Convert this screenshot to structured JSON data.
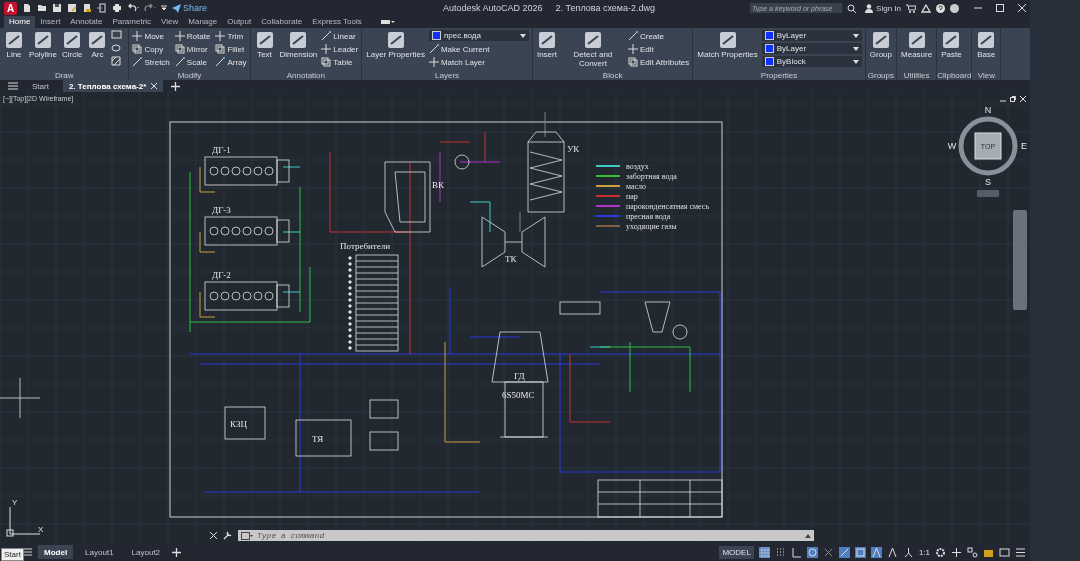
{
  "app": {
    "logo": "A",
    "share": "Share",
    "title": "Autodesk AutoCAD 2026",
    "file_name": "2. Теплова схема-2.dwg",
    "search_placeholder": "Type a keyword or phrase",
    "sign_in": "Sign In"
  },
  "ribbon_tabs": [
    {
      "label": "Home",
      "selected": true
    },
    {
      "label": "Insert",
      "selected": false
    },
    {
      "label": "Annotate",
      "selected": false
    },
    {
      "label": "Parametric",
      "selected": false
    },
    {
      "label": "View",
      "selected": false
    },
    {
      "label": "Manage",
      "selected": false
    },
    {
      "label": "Output",
      "selected": false
    },
    {
      "label": "Collaborate",
      "selected": false
    },
    {
      "label": "Express Tools",
      "selected": false
    }
  ],
  "ribbon_panels": [
    {
      "title": "Draw",
      "items": [
        {
          "label": "Line",
          "kind": "large"
        },
        {
          "label": "Polyline",
          "kind": "large"
        },
        {
          "label": "Circle",
          "kind": "large"
        },
        {
          "label": "Arc",
          "kind": "large"
        }
      ]
    },
    {
      "title": "Modify",
      "items": [
        {
          "label": "Move",
          "kind": "small"
        },
        {
          "label": "Copy",
          "kind": "small"
        },
        {
          "label": "Stretch",
          "kind": "small"
        },
        {
          "label": "Rotate",
          "kind": "small"
        },
        {
          "label": "Mirror",
          "kind": "small"
        },
        {
          "label": "Scale",
          "kind": "small"
        },
        {
          "label": "Trim",
          "kind": "small"
        },
        {
          "label": "Fillet",
          "kind": "small"
        },
        {
          "label": "Array",
          "kind": "small"
        }
      ]
    },
    {
      "title": "Annotation",
      "items": [
        {
          "label": "Text",
          "kind": "large"
        },
        {
          "label": "Dimension",
          "kind": "large"
        },
        {
          "label": "Linear",
          "kind": "small"
        },
        {
          "label": "Leader",
          "kind": "small"
        },
        {
          "label": "Table",
          "kind": "small"
        }
      ]
    },
    {
      "title": "Layers",
      "items": [
        {
          "label": "Layer Properties",
          "kind": "large"
        },
        {
          "label": "прес.вода",
          "kind": "dropdown"
        },
        {
          "label": "Make Current",
          "kind": "small"
        },
        {
          "label": "Match Layer",
          "kind": "small"
        }
      ]
    },
    {
      "title": "Block",
      "items": [
        {
          "label": "Insert",
          "kind": "large"
        },
        {
          "label": "Detect and Convert",
          "kind": "large"
        },
        {
          "label": "Create",
          "kind": "small"
        },
        {
          "label": "Edit",
          "kind": "small"
        },
        {
          "label": "Edit Attributes",
          "kind": "small"
        }
      ]
    },
    {
      "title": "Properties",
      "items": [
        {
          "label": "Match Properties",
          "kind": "large"
        },
        {
          "label": "ByLayer",
          "kind": "dropdown"
        },
        {
          "label": "ByLayer",
          "kind": "dropdown"
        },
        {
          "label": "ByBlock",
          "kind": "dropdown"
        }
      ]
    },
    {
      "title": "Groups",
      "items": [
        {
          "label": "Group",
          "kind": "large"
        }
      ]
    },
    {
      "title": "Utilities",
      "items": [
        {
          "label": "Measure",
          "kind": "large"
        }
      ]
    },
    {
      "title": "Clipboard",
      "items": [
        {
          "label": "Paste",
          "kind": "large"
        }
      ]
    },
    {
      "title": "View",
      "items": [
        {
          "label": "Base",
          "kind": "large"
        }
      ]
    }
  ],
  "file_tabs": [
    {
      "label": "Start",
      "selected": false
    },
    {
      "label": "2. Теплова схема-2*",
      "selected": true
    }
  ],
  "viewport": {
    "label": "[−][Top][2D Wireframe]",
    "view_cube": {
      "top": "TOP",
      "north": "N",
      "south": "S",
      "east": "E",
      "west": "W"
    },
    "ucs": {
      "y": "Y",
      "x": "X"
    },
    "drawing": {
      "labels": [
        "ДГ-1",
        "ДГ-3",
        "ДГ-2",
        "Потребители",
        "ВК",
        "УК",
        "ТК",
        "ГД",
        "6S50MC",
        "КЗЦ",
        "ТЯ"
      ],
      "legend": [
        {
          "label": "воздух",
          "color": "#3ec8c8"
        },
        {
          "label": "забортная вода",
          "color": "#30c040"
        },
        {
          "label": "масло",
          "color": "#c8a040"
        },
        {
          "label": "пар",
          "color": "#c83030"
        },
        {
          "label": "пароконденсатная смесь",
          "color": "#b030c8"
        },
        {
          "label": "пресная вода",
          "color": "#2838e0"
        },
        {
          "label": "уходящие газы",
          "color": "#806040"
        }
      ]
    }
  },
  "command_line": {
    "placeholder": "Type a command"
  },
  "layout_tabs": [
    {
      "label": "Model",
      "selected": true
    },
    {
      "label": "Layout1",
      "selected": false
    },
    {
      "label": "Layout2",
      "selected": false
    }
  ],
  "status_bar": {
    "space": "MODEL",
    "scale": "1:1"
  },
  "tooltip": "Start"
}
